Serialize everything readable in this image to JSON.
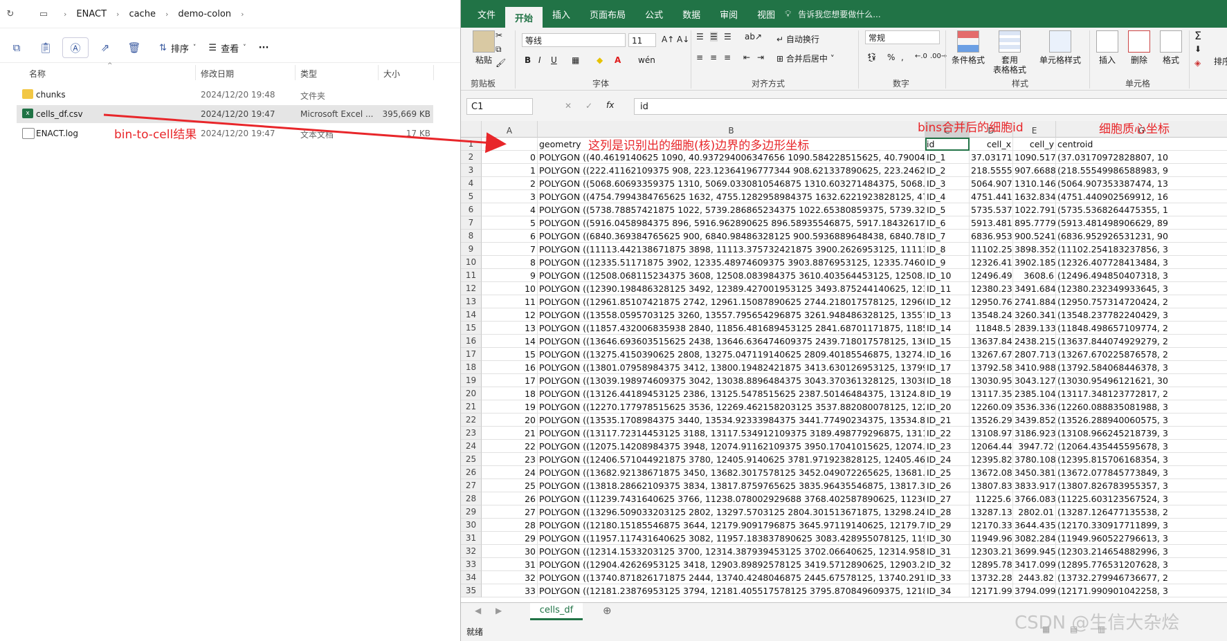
{
  "explorer": {
    "breadcrumb": [
      "ENACT",
      "cache",
      "demo-colon"
    ],
    "toolbar": {
      "sort_label": "排序",
      "view_label": "查看",
      "more_label": "···"
    },
    "columns": {
      "name": "名称",
      "modified": "修改日期",
      "type": "类型",
      "size": "大小"
    },
    "files": [
      {
        "name": "chunks",
        "modified": "2024/12/20 19:48",
        "type": "文件夹",
        "size": "",
        "kind": "folder"
      },
      {
        "name": "cells_df.csv",
        "modified": "2024/12/20 19:47",
        "type": "Microsoft Excel ...",
        "size": "395,669 KB",
        "kind": "excel"
      },
      {
        "name": "ENACT.log",
        "modified": "2024/12/20 19:47",
        "type": "文本文档",
        "size": "17 KB",
        "kind": "text"
      }
    ]
  },
  "excel": {
    "tabs": [
      "文件",
      "开始",
      "插入",
      "页面布局",
      "公式",
      "数据",
      "审阅",
      "视图"
    ],
    "active_tab": "开始",
    "tell_me": "告诉我您想要做什么...",
    "ribbon": {
      "paste": "粘贴",
      "clipboard_label": "剪贴板",
      "font_name": "等线",
      "font_size": "11",
      "font_label": "字体",
      "wrap_text": "自动换行",
      "merge_center": "合并后居中",
      "align_label": "对齐方式",
      "number_format": "常规",
      "number_label": "数字",
      "conditional_format": "条件格式",
      "table_format": "套用\n表格格式",
      "cell_styles": "单元格样式",
      "styles_label": "样式",
      "insert": "插入",
      "delete": "删除",
      "format": "格式",
      "cells_label": "单元格",
      "sort_filter": "排序"
    },
    "name_box": "C1",
    "formula": "id",
    "columns": [
      "A",
      "B",
      "C",
      "D",
      "E",
      "G"
    ],
    "header_row": [
      "",
      "geometry",
      "id",
      "cell_x",
      "cell_y",
      "centroid"
    ],
    "rows": [
      [
        "0",
        "POLYGON ((40.4619140625 1090, 40.937294006347656 1090.584228515625, 40.7900428771972",
        "ID_1",
        "37.03171",
        "1090.517",
        "(37.03170972828807, 10"
      ],
      [
        "1",
        "POLYGON ((222.41162109375 908, 223.12364196777344 908.621337890625, 223.2462768554687",
        "ID_2",
        "218.5555",
        "907.6688",
        "(218.55549986588983, 9"
      ],
      [
        "2",
        "POLYGON ((5068.60693359375 1310, 5069.0330810546875 1310.603271484375, 5068.8500976562",
        "ID_3",
        "5064.907",
        "1310.146",
        "(5064.907353387474, 13"
      ],
      [
        "3",
        "POLYGON ((4754.7994384765625 1632, 4755.1282958984375 1632.6221923828125, 4754.928833",
        "ID_4",
        "4751.441",
        "1632.834",
        "(4751.440902569912, 16"
      ],
      [
        "4",
        "POLYGON ((5738.78857421875 1022, 5739.286865234375 1022.65380859375, 5739.3210449218",
        "ID_5",
        "5735.537",
        "1022.791",
        "(5735.5368264475355, 1"
      ],
      [
        "5",
        "POLYGON ((5916.0458984375 896, 5916.962890625 896.58935546875, 5917.184326171875 897.5",
        "ID_6",
        "5913.481",
        "895.7779",
        "(5913.481498906629, 89"
      ],
      [
        "6",
        "POLYGON ((6840.369384765625 900, 6840.98486328125 900.5936889648438, 6840.7878417968",
        "ID_7",
        "6836.953",
        "900.5241",
        "(6836.952926531231, 90"
      ],
      [
        "7",
        "POLYGON ((11113.442138671875 3898, 11113.375732421875 3900.2626953125, 11113.1297607",
        "ID_8",
        "11102.25",
        "3898.352",
        "(11102.254183237856, 3"
      ],
      [
        "8",
        "POLYGON ((12335.51171875 3902, 12335.48974609375 3903.8876953125, 12335.74609375 3906",
        "ID_9",
        "12326.41",
        "3902.185",
        "(12326.407728413484, 3"
      ],
      [
        "9",
        "POLYGON ((12508.068115234375 3608, 12508.083984375 3610.403564453125, 12508.0078125 3",
        "ID_10",
        "12496.49",
        "3608.6",
        "(12496.494850407318, 3"
      ],
      [
        "10",
        "POLYGON ((12390.198486328125 3492, 12389.427001953125 3493.875244140625, 12388.773926",
        "ID_11",
        "12380.23",
        "3491.684",
        "(12380.232349933645, 3"
      ],
      [
        "11",
        "POLYGON ((12961.85107421875 2742, 12961.15087890625 2744.218017578125, 12960.8452148",
        "ID_12",
        "12950.76",
        "2741.884",
        "(12950.757314720424, 2"
      ],
      [
        "12",
        "POLYGON ((13558.0595703125 3260, 13557.795654296875 3261.948486328125, 13557.3510742",
        "ID_13",
        "13548.24",
        "3260.341",
        "(13548.237782240429, 3"
      ],
      [
        "13",
        "POLYGON ((11857.432006835938 2840, 11856.481689453125 2841.68701171875, 11856.0047607",
        "ID_14",
        "11848.5",
        "2839.133",
        "(11848.498657109774, 2"
      ],
      [
        "14",
        "POLYGON ((13646.693603515625 2438, 13646.636474609375 2439.718017578125, 13646.341796",
        "ID_15",
        "13637.84",
        "2438.215",
        "(13637.844074929279, 2"
      ],
      [
        "15",
        "POLYGON ((13275.4150390625 2808, 13275.047119140625 2809.40185546875, 13274.5417480",
        "ID_16",
        "13267.67",
        "2807.713",
        "(13267.670225876578, 2"
      ],
      [
        "16",
        "POLYGON ((13801.07958984375 3412, 13800.19482421875 3413.630126953125, 13799.5849609",
        "ID_17",
        "13792.58",
        "3410.988",
        "(13792.584068446378, 3"
      ],
      [
        "17",
        "POLYGON ((13039.198974609375 3042, 13038.8896484375 3043.370361328125, 13038.6716308",
        "ID_18",
        "13030.95",
        "3043.127",
        "(13030.95496121621, 30"
      ],
      [
        "18",
        "POLYGON ((13126.44189453125 2386, 13125.5478515625 2387.50146484375, 13124.8149414062",
        "ID_19",
        "13117.35",
        "2385.104",
        "(13117.348123772817, 2"
      ],
      [
        "19",
        "POLYGON ((12270.177978515625 3536, 12269.462158203125 3537.882080078125, 12268.939941",
        "ID_20",
        "12260.09",
        "3536.336",
        "(12260.088835081988, 3"
      ],
      [
        "20",
        "POLYGON ((13535.1708984375 3440, 13534.92333984375 3441.77490234375, 13534.8356933593",
        "ID_21",
        "13526.29",
        "3439.852",
        "(13526.288940060575, 3"
      ],
      [
        "21",
        "POLYGON ((13117.72314453125 3188, 13117.534912109375 3189.498779296875, 13117.4858398",
        "ID_22",
        "13108.97",
        "3186.923",
        "(13108.966245218739, 3"
      ],
      [
        "22",
        "POLYGON ((12075.14208984375 3948, 12074.91162109375 3950.17041015625, 12074.8212890625",
        "ID_23",
        "12064.44",
        "3947.72",
        "(12064.435445595678, 3"
      ],
      [
        "23",
        "POLYGON ((12406.571044921875 3780, 12405.9140625 3781.971923828125, 12405.4655761718",
        "ID_24",
        "12395.82",
        "3780.108",
        "(12395.815706168354, 3"
      ],
      [
        "24",
        "POLYGON ((13682.92138671875 3450, 13682.3017578125 3452.049072265625, 13681.8522949218",
        "ID_25",
        "13672.08",
        "3450.381",
        "(13672.077845773849, 3"
      ],
      [
        "25",
        "POLYGON ((13818.28662109375 3834, 13817.8759765625 3835.96435546875, 13817.3132324218",
        "ID_26",
        "13807.83",
        "3833.917",
        "(13807.826783955357, 3"
      ],
      [
        "26",
        "POLYGON ((11239.7431640625 3766, 11238.078002929688 3768.402587890625, 11236.3101806",
        "ID_27",
        "11225.6",
        "3766.083",
        "(11225.603123567524, 3"
      ],
      [
        "27",
        "POLYGON ((13296.509033203125 2802, 13297.5703125 2804.301513671875, 13298.2482910156",
        "ID_28",
        "13287.13",
        "2802.01",
        "(13287.126477135538, 2"
      ],
      [
        "28",
        "POLYGON ((12180.15185546875 3644, 12179.9091796875 3645.97119140625, 12179.7302246093",
        "ID_29",
        "12170.33",
        "3644.435",
        "(12170.330917711899, 3"
      ],
      [
        "29",
        "POLYGON ((11957.117431640625 3082, 11957.183837890625 3083.428955078125, 11957.488281",
        "ID_30",
        "11949.96",
        "3082.284",
        "(11949.960522796613, 3"
      ],
      [
        "30",
        "POLYGON ((12314.1533203125 3700, 12314.387939453125 3702.06640625, 12314.9580078125 3",
        "ID_31",
        "12303.21",
        "3699.945",
        "(12303.214654882996, 3"
      ],
      [
        "31",
        "POLYGON ((12904.42626953125 3418, 12903.89892578125 3419.5712890625, 12903.2241210937",
        "ID_32",
        "12895.78",
        "3417.099",
        "(12895.776531207628, 3"
      ],
      [
        "32",
        "POLYGON ((13740.871826171875 2444, 13740.4248046875 2445.67578125, 13740.2919921875 2",
        "ID_33",
        "13732.28",
        "2443.82",
        "(13732.279946736677, 2"
      ],
      [
        "33",
        "POLYGON ((12181.23876953125 3794, 12181.405517578125 3795.870849609375, 12181.7370605",
        "ID_34",
        "12171.99",
        "3794.099",
        "(12171.990901042258, 3"
      ]
    ],
    "sheet_name": "cells_df",
    "status": "就绪"
  },
  "annotations": {
    "bin_to_cell": "bin-to-cell结果",
    "polygon_note": "这列是识别出的细胞(核)边界的多边形坐标",
    "bins_id_note": "bins合并后的细胞id",
    "centroid_note": "细胞质心坐标",
    "arrow_color": "#e8262a"
  },
  "watermark": "CSDN @生信大杂烩",
  "colors": {
    "excel_green": "#217346",
    "annotation_red": "#e8262a"
  }
}
